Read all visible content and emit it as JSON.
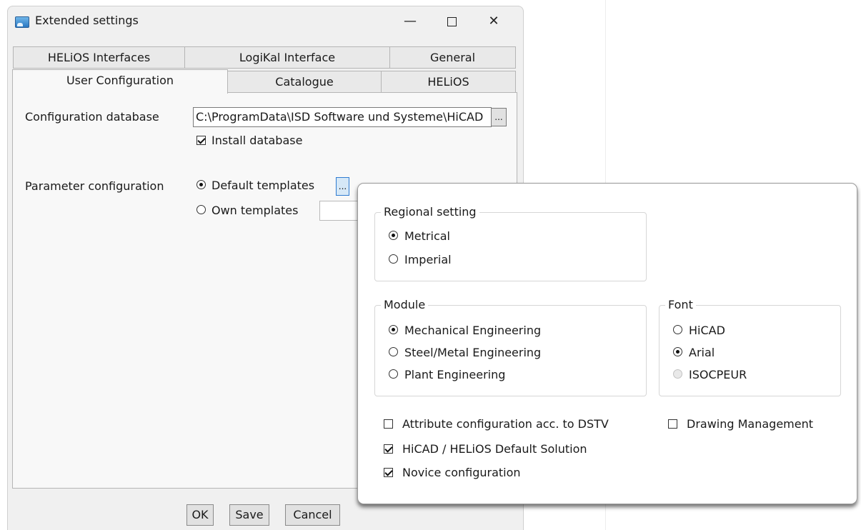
{
  "window": {
    "title": "Extended settings",
    "minimize": "—",
    "close": "✕"
  },
  "tabs": {
    "row1": [
      "HELiOS Interfaces",
      "LogiKal Interface",
      "General"
    ],
    "row2": [
      "User Configuration",
      "Catalogue",
      "HELiOS"
    ],
    "active": "User Configuration"
  },
  "user_config": {
    "config_db_label": "Configuration database",
    "config_db_value": "C:\\ProgramData\\ISD Software und Systeme\\HiCAD",
    "browse_label": "...",
    "install_db_label": "Install database",
    "install_db_checked": true,
    "param_config_label": "Parameter configuration",
    "default_templates_label": "Default templates",
    "own_templates_label": "Own templates",
    "default_templates_selected": true
  },
  "buttons": {
    "ok": "OK",
    "save": "Save",
    "cancel": "Cancel"
  },
  "popup": {
    "regional": {
      "title": "Regional setting",
      "options": [
        "Metrical",
        "Imperial"
      ],
      "selected": "Metrical"
    },
    "module": {
      "title": "Module",
      "options": [
        "Mechanical Engineering",
        "Steel/Metal Engineering",
        "Plant Engineering"
      ],
      "selected": "Mechanical Engineering"
    },
    "font": {
      "title": "Font",
      "options": [
        "HiCAD",
        "Arial",
        "ISOCPEUR"
      ],
      "selected": "Arial",
      "disabled": [
        "ISOCPEUR"
      ]
    },
    "checks": {
      "attr_dstv": {
        "label": "Attribute configuration acc. to DSTV",
        "checked": false
      },
      "drawing_mgmt": {
        "label": "Drawing Management",
        "checked": false
      },
      "default_solution": {
        "label": "HiCAD / HELiOS Default Solution",
        "checked": true
      },
      "novice": {
        "label": "Novice configuration",
        "checked": true
      }
    }
  }
}
